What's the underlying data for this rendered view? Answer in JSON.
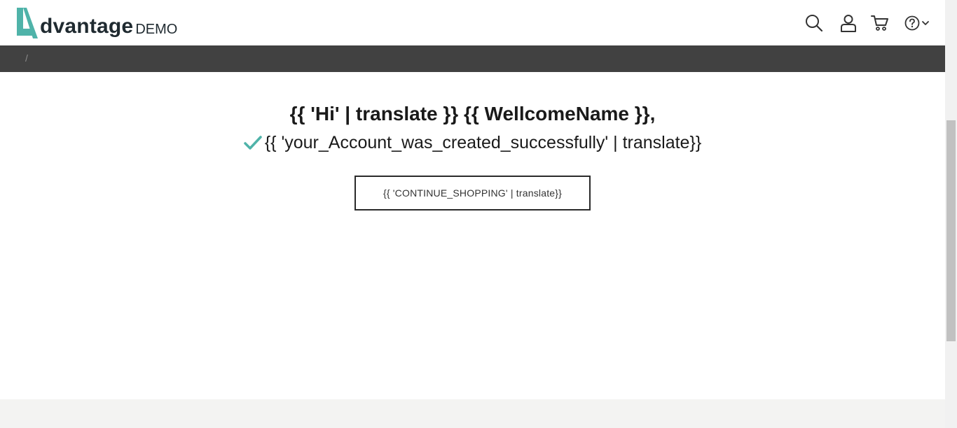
{
  "header": {
    "logo_text": "dvantage",
    "logo_suffix": "DEMO",
    "brand_color": "#4fb3a9",
    "icons": [
      "search-icon",
      "user-icon",
      "cart-icon",
      "help-icon",
      "chevron-down-icon"
    ]
  },
  "breadcrumb": {
    "separator": "/"
  },
  "main": {
    "greeting": "{{ 'Hi' | translate }} {{ WellcomeName }},",
    "success_message": "{{ 'your_Account_was_created_successfully' | translate}}",
    "success_icon": "check-icon",
    "success_icon_color": "#4fb3a9",
    "continue_button_label": "{{ 'CONTINUE_SHOPPING' | translate}}"
  },
  "colors": {
    "breadcrumb_bar": "#414141",
    "footer_strip": "#f3f3f2",
    "text": "#1a1a1a"
  }
}
